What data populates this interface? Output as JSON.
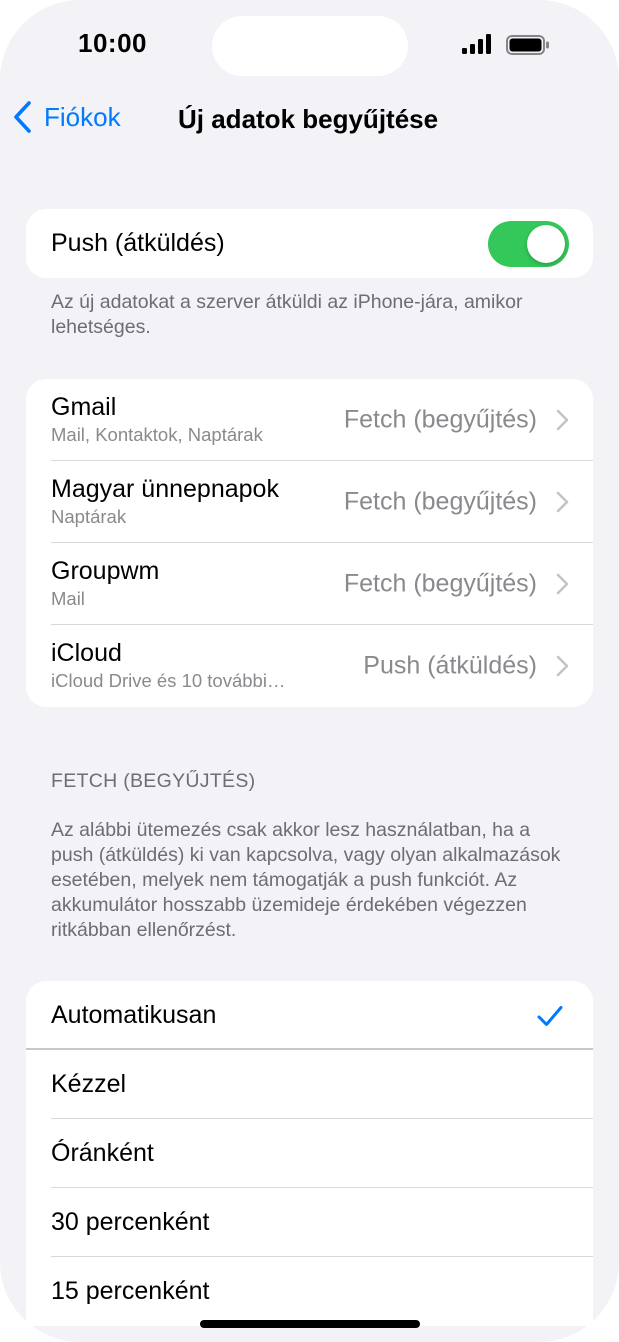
{
  "status_bar": {
    "time": "10:00",
    "icons": [
      "signal-icon",
      "battery-icon"
    ]
  },
  "nav": {
    "back_label": "Fiókok",
    "title": "Új adatok begyűjtése"
  },
  "push": {
    "label": "Push (átküldés)",
    "enabled": true,
    "footer": "Az új adatokat a szerver átküldi az iPhone-jára, amikor lehetséges."
  },
  "accounts": [
    {
      "name": "Gmail",
      "services": "Mail, Kontaktok, Naptárak",
      "mode": "Fetch (begyűjtés)"
    },
    {
      "name": "Magyar ünnepnapok",
      "services": "Naptárak",
      "mode": "Fetch (begyűjtés)"
    },
    {
      "name": "Groupwm",
      "services": "Mail",
      "mode": "Fetch (begyűjtés)"
    },
    {
      "name": "iCloud",
      "services": "iCloud Drive és 10 további…",
      "mode": "Push (átküldés)"
    }
  ],
  "fetch": {
    "header": "FETCH (BEGYŰJTÉS)",
    "description": "Az alábbi ütemezés csak akkor lesz használatban, ha a push (átküldés) ki van kapcsolva, vagy olyan alkalmazások esetében, melyek nem támogatják a push funkciót. Az akkumulátor hosszabb üzemideje érdekében végezzen ritkábban ellenőrzést.",
    "options": [
      "Automatikusan",
      "Kézzel",
      "Óránként",
      "30 percenként",
      "15 percenként"
    ],
    "selected": "Automatikusan"
  },
  "colors": {
    "accent": "#007aff",
    "toggle_on": "#34c759",
    "background": "#f2f2f7",
    "secondary_text": "#8a8a8e"
  }
}
